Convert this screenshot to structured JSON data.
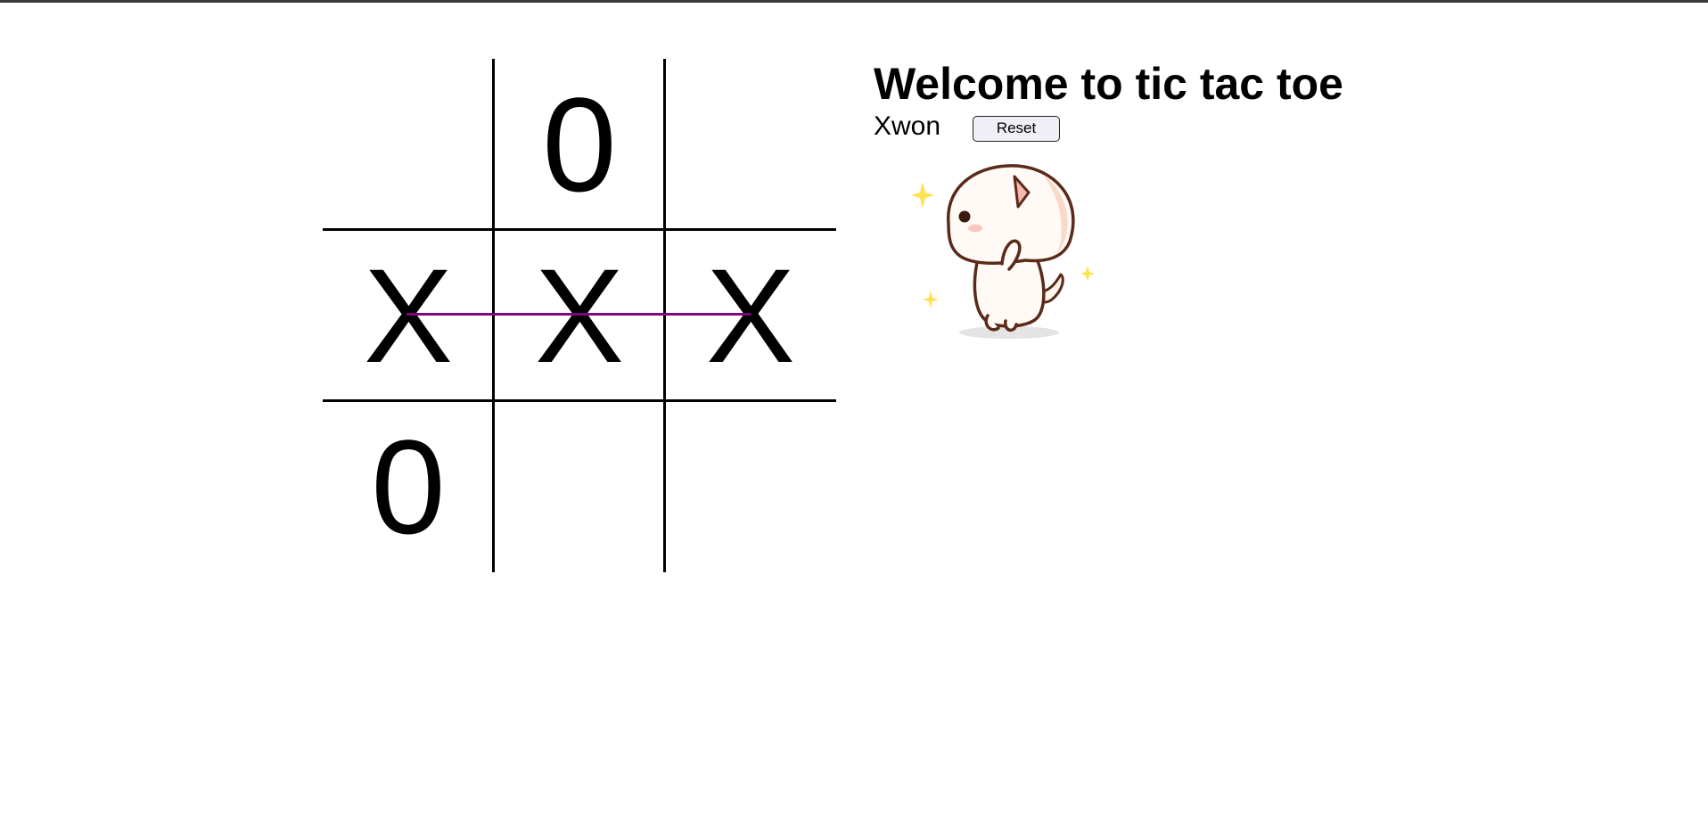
{
  "game": {
    "title": "Welcome to tic tac toe",
    "status": "Xwon",
    "reset_label": "Reset",
    "board": [
      [
        "",
        "0",
        ""
      ],
      [
        "X",
        "X",
        "X"
      ],
      [
        "0",
        "",
        ""
      ]
    ],
    "winning_line": {
      "row": 1,
      "color": "#800080"
    }
  },
  "illustration": {
    "icon": "celebrating-cat-sticker-icon"
  }
}
